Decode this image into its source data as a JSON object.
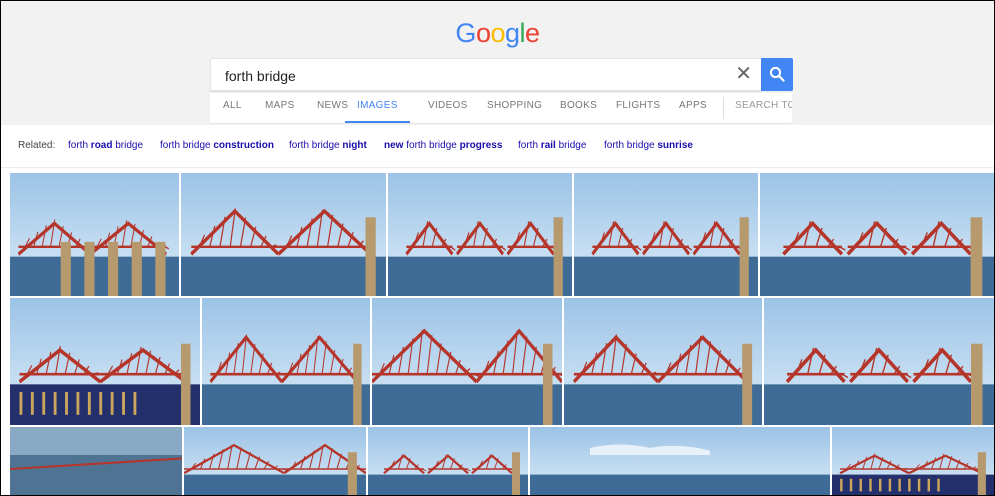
{
  "logo": {
    "letters": [
      "G",
      "o",
      "o",
      "g",
      "l",
      "e"
    ],
    "colors": [
      "#4285f4",
      "#ea4335",
      "#fbbc05",
      "#4285f4",
      "#34a853",
      "#ea4335"
    ]
  },
  "search": {
    "value": "forth bridge",
    "clear_icon": "close-icon",
    "button_icon": "search-icon",
    "button_color": "#4285f4"
  },
  "tabs": [
    {
      "label": "ALL",
      "active": false
    },
    {
      "label": "MAPS",
      "active": false
    },
    {
      "label": "NEWS",
      "active": false
    },
    {
      "label": "IMAGES",
      "active": true
    },
    {
      "label": "VIDEOS",
      "active": false
    },
    {
      "label": "SHOPPING",
      "active": false
    },
    {
      "label": "BOOKS",
      "active": false
    },
    {
      "label": "FLIGHTS",
      "active": false
    },
    {
      "label": "APPS",
      "active": false
    },
    {
      "label": "SEARCH TO",
      "active": false
    }
  ],
  "related": {
    "label": "Related:",
    "items": [
      {
        "pre": "forth ",
        "bold": "road",
        "post": " bridge"
      },
      {
        "pre": "forth bridge ",
        "bold": "construction",
        "post": ""
      },
      {
        "pre": "forth bridge ",
        "bold": "night",
        "post": ""
      },
      {
        "pre": "",
        "bold": "new",
        "post": " forth bridge "
      },
      {
        "pre": "",
        "bold": "progress",
        "post": ""
      },
      {
        "pre": "forth ",
        "bold": "rail",
        "post": " bridge"
      },
      {
        "pre": "forth bridge ",
        "bold": "sunrise",
        "post": ""
      }
    ]
  },
  "images": {
    "subject": "Forth Bridge photos",
    "palette": {
      "sky": "#9cc3e6",
      "water": "#3e6c96",
      "bridge": "#b5352a",
      "stone": "#b69a6e"
    }
  }
}
